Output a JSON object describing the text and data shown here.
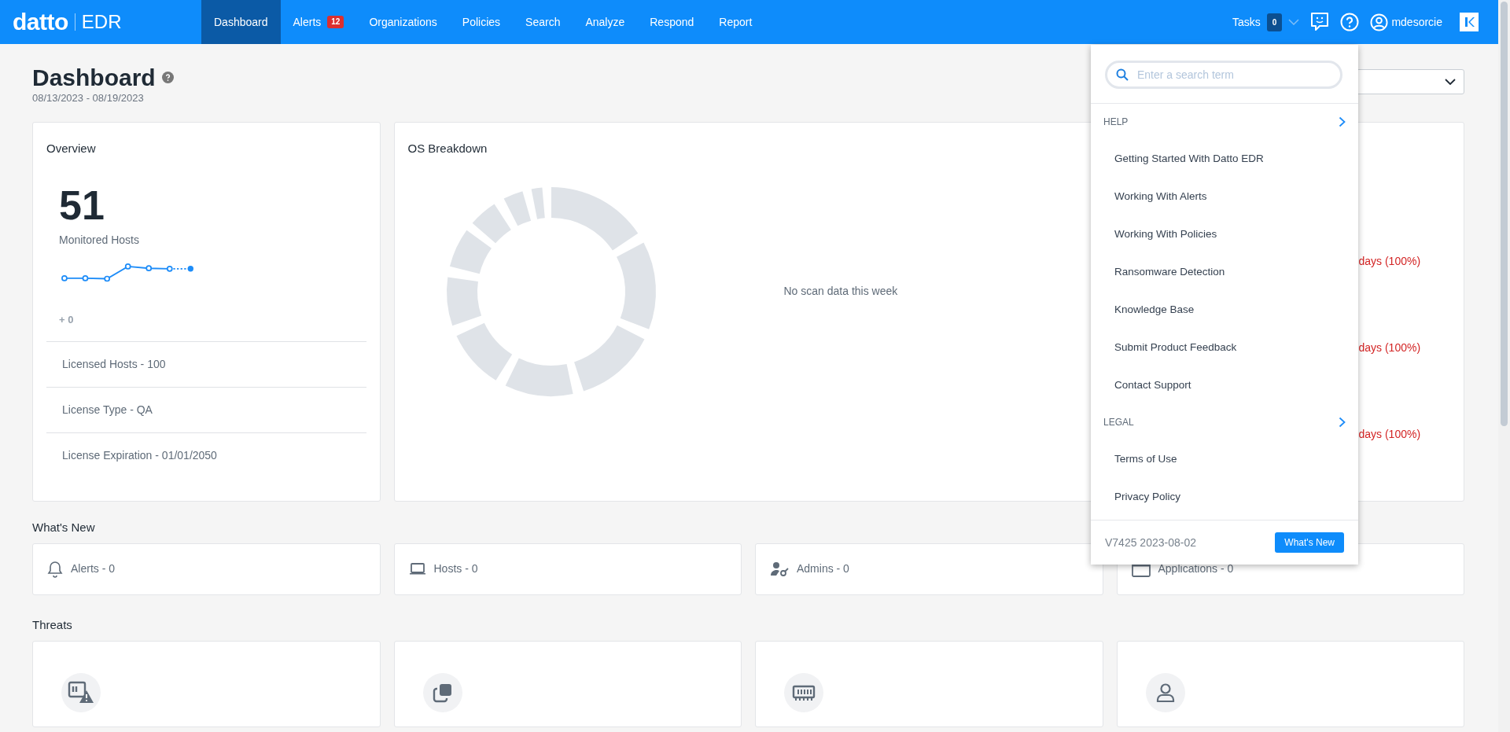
{
  "navbar": {
    "logo": "datto",
    "product": "EDR",
    "items": [
      {
        "label": "Dashboard",
        "selected": true
      },
      {
        "label": "Alerts",
        "selected": false,
        "badge": "12"
      },
      {
        "label": "Organizations",
        "selected": false
      },
      {
        "label": "Policies",
        "selected": false
      },
      {
        "label": "Search",
        "selected": false
      },
      {
        "label": "Analyze",
        "selected": false
      },
      {
        "label": "Respond",
        "selected": false
      },
      {
        "label": "Report",
        "selected": false
      }
    ],
    "tasks": {
      "label": "Tasks",
      "count": "0"
    },
    "user": "mdesorcie"
  },
  "page": {
    "title": "Dashboard",
    "date_range": "08/13/2023 - 08/19/2023"
  },
  "overview": {
    "title": "Overview",
    "count": "51",
    "count_label": "Monitored Hosts",
    "change": "+ 0",
    "details": [
      "Licensed Hosts - 100",
      "License Type - QA",
      "License Expiration - 01/01/2050"
    ]
  },
  "os_breakdown": {
    "title": "OS Breakdown",
    "message": "No scan data this week"
  },
  "card_3": {
    "lines": [
      "days (100%)",
      "days (100%)",
      "days (100%)"
    ]
  },
  "whats_new": {
    "title": "What's New",
    "items": [
      {
        "kind": "alerts",
        "label": "Alerts - 0"
      },
      {
        "kind": "hosts",
        "label": "Hosts - 0"
      },
      {
        "kind": "admins",
        "label": "Admins - 0"
      },
      {
        "kind": "applications",
        "label": "Applications - 0"
      }
    ]
  },
  "threats": {
    "title": "Threats",
    "items": [
      {
        "kind": "monitor-warning"
      },
      {
        "kind": "copy"
      },
      {
        "kind": "memory"
      },
      {
        "kind": "user"
      }
    ]
  },
  "help_menu": {
    "search": {
      "placeholder": "Enter a search term"
    },
    "sections": [
      {
        "title": "HELP",
        "items": [
          "Getting Started With Datto EDR",
          "Working With Alerts",
          "Working With Policies",
          "Ransomware Detection",
          "Knowledge Base",
          "Submit Product Feedback",
          "Contact Support"
        ]
      },
      {
        "title": "LEGAL",
        "items": [
          "Terms of Use",
          "Privacy Policy"
        ]
      }
    ],
    "version": "V7425 2023-08-02",
    "button": "What's New"
  }
}
